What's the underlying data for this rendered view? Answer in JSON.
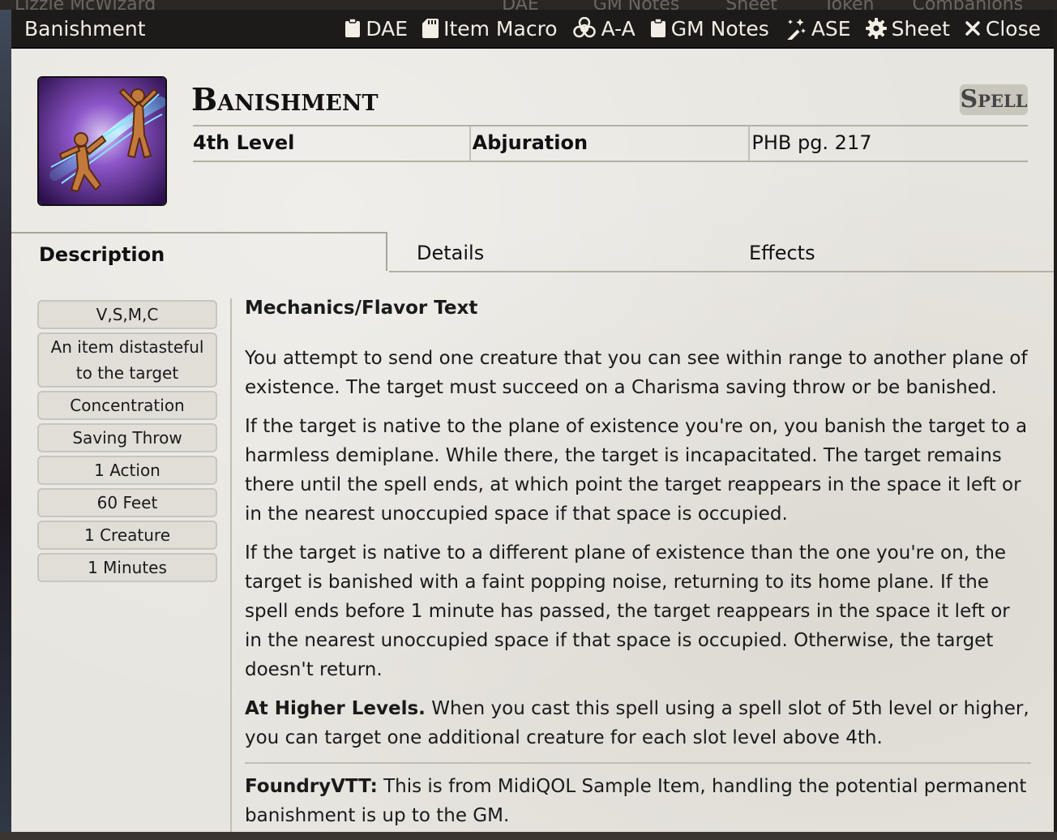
{
  "background_title": "Lizzie McWizard",
  "background_buttons": [
    "DAE",
    "GM Notes",
    "Sheet",
    "Token",
    "Companions"
  ],
  "window": {
    "title": "Banishment",
    "buttons": [
      {
        "label": "DAE",
        "icon": "clipboard-icon"
      },
      {
        "label": "Item Macro",
        "icon": "sd-card-icon"
      },
      {
        "label": "A-A",
        "icon": "biohazard-icon"
      },
      {
        "label": "GM Notes",
        "icon": "clipboard-icon"
      },
      {
        "label": "ASE",
        "icon": "magic-wand-icon"
      },
      {
        "label": "Sheet",
        "icon": "gear-icon"
      },
      {
        "label": "Close",
        "icon": "close-icon"
      }
    ]
  },
  "item": {
    "name": "Banishment",
    "type": "Spell",
    "level": "4th Level",
    "school": "Abjuration",
    "source": "PHB pg. 217"
  },
  "tabs": [
    "Description",
    "Details",
    "Effects"
  ],
  "properties": [
    "V,S,M,C",
    "An item distasteful to the target",
    "Concentration",
    "Saving Throw",
    "1 Action",
    "60 Feet",
    "1 Creature",
    "1 Minutes"
  ],
  "description": {
    "heading": "Mechanics/Flavor Text",
    "p1": "You attempt to send one creature that you can see within range to another plane of existence. The target must succeed on a Charisma saving throw or be banished.",
    "p2": "If the target is native to the plane of existence you're on, you banish the target to a harmless demiplane. While there, the target is incapacitated. The target remains there until the spell ends, at which point the target reappears in the space it left or in the nearest unoccupied space if that space is occupied.",
    "p3": "If the target is native to a different plane of existence than the one you're on, the target is banished with a faint popping noise, returning to its home plane. If the spell ends before 1 minute has passed, the target reappears in the space it left or in the nearest unoccupied space if that space is occupied. Otherwise, the target doesn't return.",
    "higher_label": "At Higher Levels.",
    "higher_text": " When you cast this spell using a spell slot of 5th level or higher, you can target one additional creature for each slot level above 4th.",
    "note_label": "FoundryVTT:",
    "note_text": " This is from MidiQOL Sample Item, handling the potential permanent banishment is up to the GM."
  }
}
